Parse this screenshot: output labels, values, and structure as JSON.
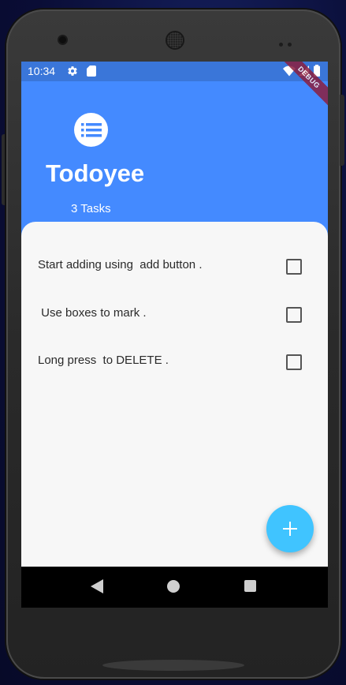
{
  "status_bar": {
    "time": "10:34",
    "icons": [
      "gear-icon",
      "sd-card-icon",
      "wifi-icon",
      "signal-icon",
      "battery-icon"
    ]
  },
  "debug_banner": "DEBUG",
  "header": {
    "icon": "list-icon",
    "title": "Todoyee",
    "task_count": "3 Tasks"
  },
  "tasks": [
    {
      "text": "Start adding using  add button .",
      "checked": false
    },
    {
      "text": " Use boxes to mark .",
      "checked": false
    },
    {
      "text": "Long press  to DELETE .",
      "checked": false
    }
  ],
  "fab": {
    "icon": "plus-icon"
  },
  "nav_bar": {
    "icons": [
      "back-icon",
      "home-icon",
      "recents-icon"
    ]
  },
  "colors": {
    "header_bg": "#448aff",
    "status_bg": "#3a76d9",
    "panel_bg": "#f7f7f7",
    "fab_bg": "#40c4ff",
    "debug_banner": "#8b1e3f"
  }
}
